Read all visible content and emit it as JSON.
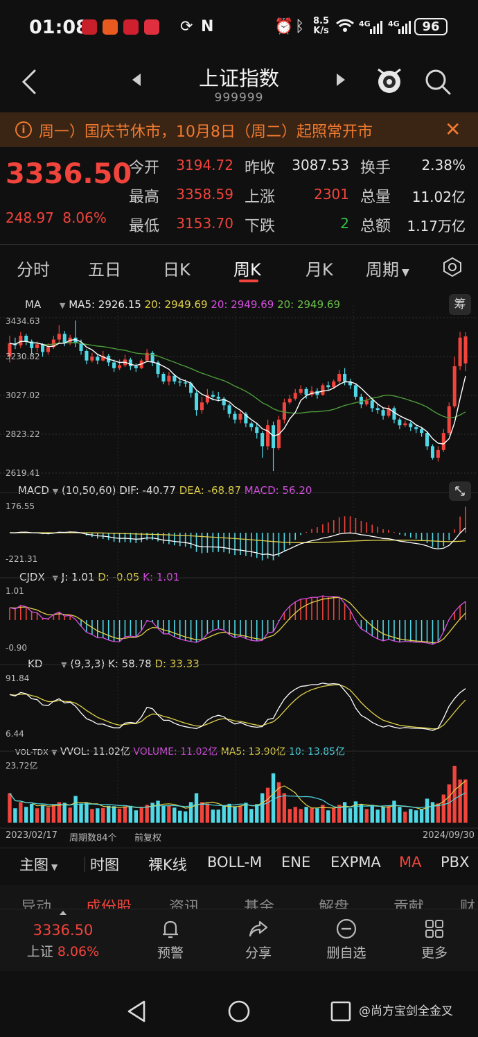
{
  "status_bar": {
    "time": "01:08",
    "net_speed_value": "8.5",
    "net_speed_unit": "K/s",
    "signal_1": "4G",
    "signal_2": "4G",
    "battery": "96"
  },
  "header": {
    "title": "上证指数",
    "code": "999999"
  },
  "notice": {
    "text": "周一）国庆节休市，10月8日（周二）起照常开市"
  },
  "quote": {
    "price": "3336.50",
    "change": "248.97",
    "change_pct": "8.06%",
    "rows": [
      [
        {
          "label": "今开",
          "value": "3194.72",
          "color": "#f0443c"
        },
        {
          "label": "昨收",
          "value": "3087.53",
          "color": "#e6e6e6"
        },
        {
          "label": "换手",
          "value": "2.38%",
          "color": "#e6e6e6"
        }
      ],
      [
        {
          "label": "最高",
          "value": "3358.59",
          "color": "#f0443c"
        },
        {
          "label": "上涨",
          "value": "2301",
          "color": "#f0443c"
        },
        {
          "label": "总量",
          "value": "11.02亿",
          "color": "#e6e6e6"
        }
      ],
      [
        {
          "label": "最低",
          "value": "3153.70",
          "color": "#f0443c"
        },
        {
          "label": "下跌",
          "value": "2",
          "color": "#35c24a"
        },
        {
          "label": "总额",
          "value": "1.17万亿",
          "color": "#e6e6e6"
        }
      ]
    ]
  },
  "tabs": [
    "分时",
    "五日",
    "日K",
    "周K",
    "月K",
    "周期"
  ],
  "active_tab": "周K",
  "main_chart": {
    "indicator": "MA",
    "ma5_label": "MA5: 2926.15",
    "ma20_y_label": "20: 2949.69",
    "ma20_m_label": "20: 2949.69",
    "ma20_g_label": "20: 2949.69",
    "chip_button": "筹",
    "y_ticks": [
      "3434.63",
      "3230.82",
      "3027.02",
      "2823.22",
      "2619.41"
    ]
  },
  "macd": {
    "name": "MACD",
    "params": "(10,50,60)",
    "dif_label": "DIF: -40.77",
    "dea_label": "DEA: -68.87",
    "macd_label": "MACD: 56.20",
    "y_ticks": [
      "176.55",
      "-221.31"
    ]
  },
  "cjdx": {
    "name": "CJDX",
    "j_label": "J: 1.01",
    "d_label": "D: -0.05",
    "k_label": "K: 1.01",
    "y_ticks": [
      "1.01",
      "-0.90"
    ]
  },
  "kd": {
    "name": "KD",
    "params": "(9,3,3)",
    "k_label": "K: 58.78",
    "d_label": "D: 33.33",
    "y_ticks": [
      "91.84",
      "6.44"
    ]
  },
  "vol": {
    "name": "VOL-TDX",
    "vvol_label": "VVOL: 11.02亿",
    "volume_label": "VOLUME: 11.02亿",
    "ma5_label": "MA5: 13.90亿",
    "ma10_label": "10: 13.85亿",
    "y_ticks": [
      "23.72亿"
    ]
  },
  "footer_info": {
    "start_date": "2023/02/17",
    "count": "周期数84个",
    "adjust": "前复权",
    "end_date": "2024/09/30"
  },
  "indicator_selector": [
    "主图",
    "时图",
    "裸K线",
    "BOLL-M",
    "ENE",
    "EXPMA",
    "MA",
    "PBX"
  ],
  "section_tabs": [
    "异动",
    "成份股",
    "资讯",
    "基金",
    "解盘",
    "贡献",
    "财"
  ],
  "bottom_bar": {
    "quote_price": "3336.50",
    "quote_name": "上证",
    "quote_pct": "8.06%",
    "items": [
      "预警",
      "分享",
      "删自选",
      "更多"
    ]
  },
  "watermark": "@尚方宝剑全金叉",
  "colors": {
    "up": "#f0443c",
    "down": "#4fd8e6",
    "accent_orange": "#f07a30",
    "ma5": "#ffffff",
    "ma20_yellow": "#e0d14a",
    "ma20_green": "#4c9a3a"
  },
  "chart_data": {
    "type": "candlestick",
    "x": [
      "2023/02/17",
      "2024/09/30"
    ],
    "ylim": [
      2619.41,
      3434.63
    ],
    "last_close": 3336.5,
    "candles": [
      [
        3230,
        3300,
        3340,
        3200
      ],
      [
        3300,
        3290,
        3330,
        3270
      ],
      [
        3290,
        3340,
        3360,
        3275
      ],
      [
        3340,
        3310,
        3350,
        3290
      ],
      [
        3310,
        3275,
        3320,
        3240
      ],
      [
        3275,
        3295,
        3310,
        3255
      ],
      [
        3295,
        3255,
        3300,
        3230
      ],
      [
        3255,
        3280,
        3300,
        3240
      ],
      [
        3280,
        3320,
        3340,
        3270
      ],
      [
        3320,
        3350,
        3395,
        3300
      ],
      [
        3350,
        3300,
        3365,
        3285
      ],
      [
        3300,
        3330,
        3345,
        3290
      ],
      [
        3330,
        3300,
        3420,
        3280
      ],
      [
        3300,
        3260,
        3320,
        3240
      ],
      [
        3260,
        3210,
        3270,
        3190
      ],
      [
        3210,
        3230,
        3250,
        3200
      ],
      [
        3230,
        3210,
        3245,
        3190
      ],
      [
        3210,
        3235,
        3260,
        3205
      ],
      [
        3235,
        3200,
        3245,
        3180
      ],
      [
        3200,
        3170,
        3215,
        3150
      ],
      [
        3170,
        3185,
        3215,
        3160
      ],
      [
        3185,
        3215,
        3240,
        3175
      ],
      [
        3215,
        3180,
        3225,
        3160
      ],
      [
        3180,
        3170,
        3195,
        3150
      ],
      [
        3170,
        3210,
        3220,
        3165
      ],
      [
        3210,
        3250,
        3270,
        3200
      ],
      [
        3250,
        3200,
        3260,
        3180
      ],
      [
        3200,
        3140,
        3210,
        3120
      ],
      [
        3140,
        3100,
        3150,
        3085
      ],
      [
        3100,
        3130,
        3150,
        3080
      ],
      [
        3130,
        3100,
        3140,
        3085
      ],
      [
        3100,
        3095,
        3120,
        3075
      ],
      [
        3095,
        3090,
        3110,
        3070
      ],
      [
        3090,
        3040,
        3100,
        3015
      ],
      [
        3040,
        2950,
        3050,
        2920
      ],
      [
        2950,
        2990,
        3020,
        2930
      ],
      [
        2990,
        3030,
        3060,
        2980
      ],
      [
        3030,
        3020,
        3050,
        3000
      ],
      [
        3020,
        3010,
        3045,
        2995
      ],
      [
        3010,
        2975,
        3020,
        2950
      ],
      [
        2975,
        2930,
        2985,
        2910
      ],
      [
        2930,
        2900,
        2945,
        2880
      ],
      [
        2900,
        2930,
        2950,
        2880
      ],
      [
        2930,
        2880,
        2940,
        2860
      ],
      [
        2880,
        2860,
        2890,
        2840
      ],
      [
        2860,
        2830,
        2880,
        2800
      ],
      [
        2830,
        2760,
        2840,
        2700
      ],
      [
        2760,
        2870,
        2900,
        2740
      ],
      [
        2870,
        2750,
        2890,
        2630
      ],
      [
        2750,
        2900,
        2920,
        2740
      ],
      [
        2900,
        2990,
        3010,
        2880
      ],
      [
        2990,
        3010,
        3030,
        2980
      ],
      [
        3010,
        3040,
        3060,
        3000
      ],
      [
        3040,
        3060,
        3080,
        3030
      ],
      [
        3060,
        3030,
        3070,
        3010
      ],
      [
        3030,
        3050,
        3075,
        3020
      ],
      [
        3050,
        3030,
        3065,
        3010
      ],
      [
        3030,
        3080,
        3090,
        3025
      ],
      [
        3080,
        3070,
        3100,
        3055
      ],
      [
        3070,
        3100,
        3110,
        3060
      ],
      [
        3100,
        3140,
        3160,
        3090
      ],
      [
        3140,
        3100,
        3170,
        3080
      ],
      [
        3100,
        3080,
        3115,
        3060
      ],
      [
        3080,
        3020,
        3090,
        3005
      ],
      [
        3020,
        2980,
        3035,
        2960
      ],
      [
        2980,
        3000,
        3020,
        2970
      ],
      [
        3000,
        2960,
        3010,
        2940
      ],
      [
        2960,
        2950,
        2980,
        2930
      ],
      [
        2950,
        2920,
        2960,
        2900
      ],
      [
        2920,
        2960,
        2975,
        2910
      ],
      [
        2960,
        2900,
        2970,
        2880
      ],
      [
        2900,
        2870,
        2910,
        2850
      ],
      [
        2870,
        2880,
        2895,
        2860
      ],
      [
        2880,
        2860,
        2890,
        2840
      ],
      [
        2860,
        2850,
        2875,
        2830
      ],
      [
        2850,
        2830,
        2860,
        2810
      ],
      [
        2830,
        2760,
        2840,
        2740
      ],
      [
        2760,
        2700,
        2770,
        2690
      ],
      [
        2700,
        2740,
        2760,
        2680
      ],
      [
        2740,
        2830,
        2850,
        2730
      ],
      [
        2830,
        2970,
        2990,
        2820
      ],
      [
        2970,
        3180,
        3230,
        2960
      ],
      [
        3180,
        3330,
        3360,
        3160
      ],
      [
        3194.72,
        3336.5,
        3358.59,
        3153.7
      ]
    ]
  }
}
